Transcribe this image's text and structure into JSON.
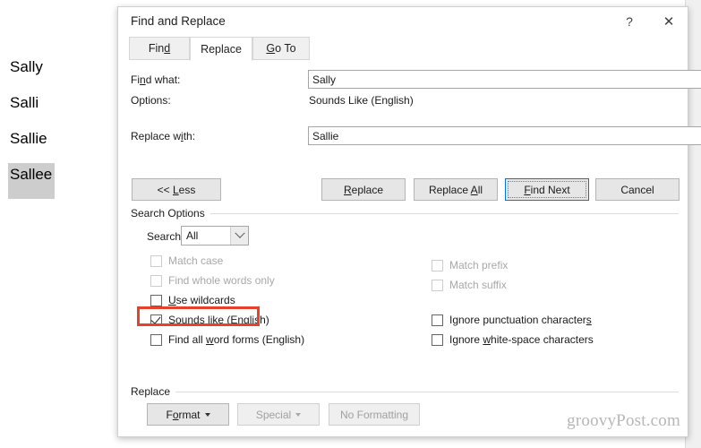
{
  "document": {
    "lines": [
      {
        "text": "Sally",
        "selected": false
      },
      {
        "text": "Salli",
        "selected": false
      },
      {
        "text": "Sallie",
        "selected": false
      },
      {
        "text": "Sallee",
        "selected": true
      }
    ]
  },
  "dialog": {
    "title": "Find and Replace",
    "help_icon": "question-mark-icon",
    "close_icon": "close-icon",
    "help_label": "?",
    "close_label": "✕",
    "tabs": [
      {
        "label": "Find",
        "accel": "d",
        "active": false
      },
      {
        "label": "Replace",
        "accel": "",
        "active": true
      },
      {
        "label": "Go To",
        "accel": "G",
        "active": false
      }
    ],
    "find": {
      "label": "Find what:",
      "label_pre": "Fi",
      "label_accel": "n",
      "label_post": "d what:",
      "value": "Sally",
      "dropdown_icon": "chevron-down-icon"
    },
    "options": {
      "label": "Options:",
      "value": "Sounds Like (English)"
    },
    "replace_with": {
      "label_pre": "Replace w",
      "label_accel": "i",
      "label_post": "th:",
      "value": "Sallie",
      "dropdown_icon": "chevron-down-icon"
    },
    "buttons": {
      "less": {
        "pre": "<< ",
        "accel": "L",
        "post": "ess",
        "disabled": false,
        "focused": false
      },
      "replace": {
        "pre": "",
        "accel": "R",
        "post": "eplace",
        "disabled": false,
        "focused": false
      },
      "replace_all": {
        "pre": "Replace ",
        "accel": "A",
        "post": "ll",
        "disabled": false,
        "focused": false
      },
      "find_next": {
        "pre": "",
        "accel": "F",
        "post": "ind Next",
        "disabled": false,
        "focused": true
      },
      "cancel": {
        "pre": "Cancel",
        "accel": "",
        "post": "",
        "disabled": false,
        "focused": false
      }
    },
    "search_options": {
      "group_label": "Search Options",
      "search_label_pre": "Search",
      "search_label_accel": ":",
      "search_value": "All",
      "search_dropdown_icon": "chevron-down-icon",
      "left_column": [
        {
          "pre": "Match case",
          "accel": "",
          "post": "",
          "checked": false,
          "disabled": true
        },
        {
          "pre": "Find whole words only",
          "accel": "",
          "post": "",
          "checked": false,
          "disabled": true
        },
        {
          "pre": "",
          "accel": "U",
          "post": "se wildcards",
          "checked": false,
          "disabled": false
        },
        {
          "pre": "Sounds li",
          "accel": "k",
          "post": "e (English)",
          "checked": true,
          "disabled": false
        },
        {
          "pre": "Find all ",
          "accel": "w",
          "post": "ord forms (English)",
          "checked": false,
          "disabled": false
        }
      ],
      "right_column": [
        {
          "pre": "Match prefix",
          "accel": "",
          "post": "",
          "checked": false,
          "disabled": true
        },
        {
          "pre": "Match suffix",
          "accel": "",
          "post": "",
          "checked": false,
          "disabled": true
        },
        {
          "pre": "Ignore punctuation character",
          "accel": "s",
          "post": "",
          "checked": false,
          "disabled": false
        },
        {
          "pre": "Ignore ",
          "accel": "w",
          "post": "hite-space characters",
          "checked": false,
          "disabled": false
        }
      ],
      "annotation_color": "#e8402a"
    },
    "replace_group": {
      "group_label": "Replace",
      "format": {
        "pre": "F",
        "accel": "o",
        "post": "rmat",
        "has_caret": true,
        "disabled": false
      },
      "special": {
        "pre": "Special",
        "accel": "",
        "post": "",
        "has_caret": true,
        "disabled": true
      },
      "no_format": {
        "pre": "No Formatting",
        "accel": "",
        "post": "",
        "has_caret": false,
        "disabled": true
      }
    }
  },
  "watermark": "groovyPost.com"
}
